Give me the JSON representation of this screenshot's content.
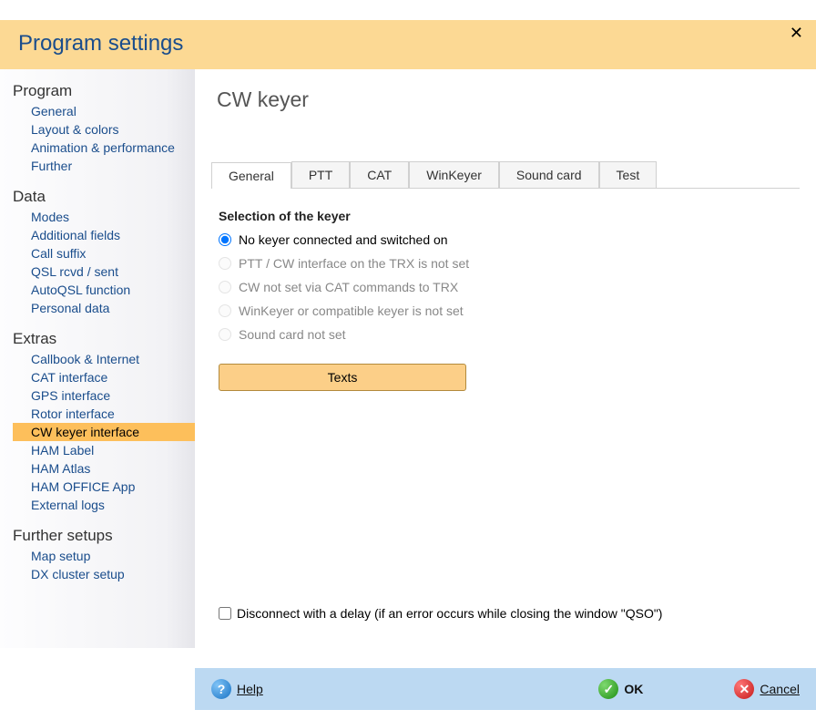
{
  "window": {
    "title": "Program settings"
  },
  "sidebar": {
    "groups": [
      {
        "title": "Program",
        "items": [
          "General",
          "Layout & colors",
          "Animation & performance",
          "Further"
        ]
      },
      {
        "title": "Data",
        "items": [
          "Modes",
          "Additional fields",
          "Call suffix",
          "QSL rcvd / sent",
          "AutoQSL function",
          "Personal data"
        ]
      },
      {
        "title": "Extras",
        "items": [
          "Callbook & Internet",
          "CAT interface",
          "GPS interface",
          "Rotor interface",
          "CW keyer interface",
          "HAM Label",
          "HAM Atlas",
          "HAM OFFICE App",
          "External logs"
        ]
      },
      {
        "title": "Further setups",
        "items": [
          "Map setup",
          "DX cluster setup"
        ]
      }
    ],
    "selected": "CW keyer interface"
  },
  "panel": {
    "title": "CW keyer",
    "tabs": [
      "General",
      "PTT",
      "CAT",
      "WinKeyer",
      "Sound card",
      "Test"
    ],
    "active_tab": "General",
    "section_label": "Selection of the keyer",
    "radios": [
      {
        "label": "No keyer connected and switched on",
        "enabled": true,
        "checked": true
      },
      {
        "label": "PTT / CW interface on the TRX is not set",
        "enabled": false,
        "checked": false
      },
      {
        "label": "CW not set via CAT commands to TRX",
        "enabled": false,
        "checked": false
      },
      {
        "label": "WinKeyer or compatible keyer is not set",
        "enabled": false,
        "checked": false
      },
      {
        "label": "Sound card not set",
        "enabled": false,
        "checked": false
      }
    ],
    "texts_button": "Texts",
    "disconnect_checkbox": "Disconnect with a delay (if an error occurs while closing the window \"QSO\")"
  },
  "bottom": {
    "help": "Help",
    "ok": "OK",
    "cancel": "Cancel"
  }
}
